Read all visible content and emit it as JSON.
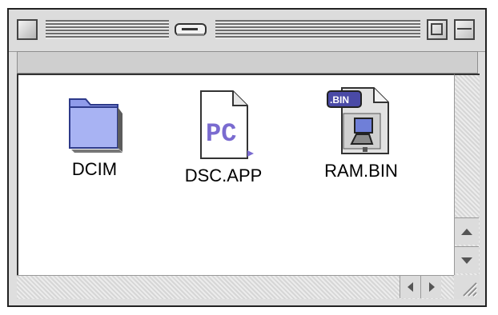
{
  "window": {
    "close_icon": "close-box-icon",
    "title_icon": "disk-drive-icon",
    "zoom_icon": "zoom-box-icon",
    "collapse_icon": "windowshade-box-icon"
  },
  "files": [
    {
      "name": "DCIM",
      "icon": "folder-icon"
    },
    {
      "name": "DSC.APP",
      "icon": "pc-document-icon"
    },
    {
      "name": "RAM.BIN",
      "icon": "binary-file-icon",
      "badge": ".BIN"
    }
  ],
  "scrollbars": {
    "up_icon": "scroll-up-arrow-icon",
    "down_icon": "scroll-down-arrow-icon",
    "left_icon": "scroll-left-arrow-icon",
    "right_icon": "scroll-right-arrow-icon",
    "resize_icon": "grow-box-icon"
  },
  "colors": {
    "folder": "#9aa6ef",
    "pc_text": "#7a6bd0",
    "window_frame": "#dcdcdc"
  }
}
